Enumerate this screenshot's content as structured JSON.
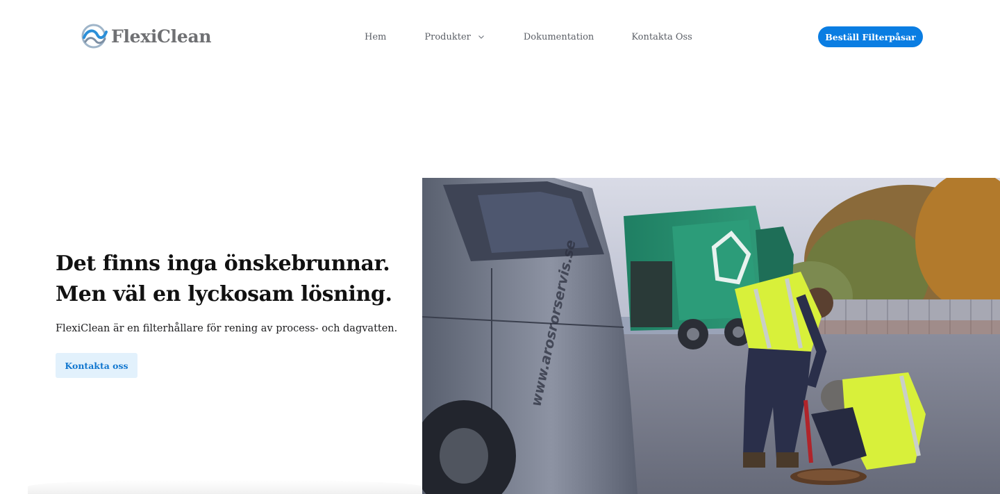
{
  "brand": {
    "name": "FlexiClean",
    "accent": "#0a7de2",
    "logo_icon": "wave-drop-icon"
  },
  "nav": {
    "items": [
      {
        "label": "Hem"
      },
      {
        "label": "Produkter",
        "icon": "chevron-down-icon"
      },
      {
        "label": "Dokumentation"
      },
      {
        "label": "Kontakta Oss"
      }
    ],
    "order_button": "Beställ Filterpåsar"
  },
  "hero": {
    "title_line1": "Det finns inga önskebrunnar.",
    "title_line2": "Men väl en lyckosam lösning.",
    "text": "FlexiClean är en filterhållare för rening av process- och dagvatten.",
    "cta": "Kontakta oss",
    "cta_bg": "#e2f1fc",
    "cta_color": "#1277cf"
  },
  "photo": {
    "van_text": "www.arosrorservis.se"
  }
}
